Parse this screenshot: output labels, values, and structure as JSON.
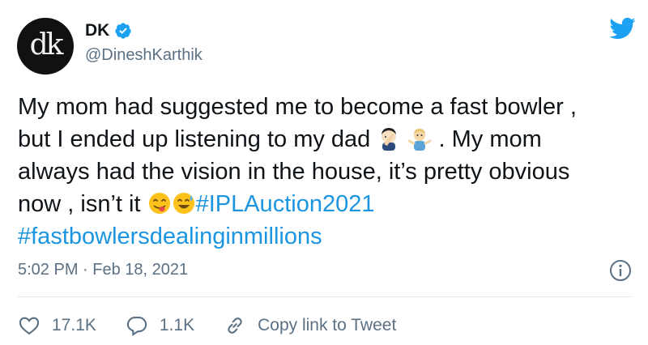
{
  "author": {
    "display_name": "DK",
    "handle": "@DineshKarthik",
    "avatar_text": "dk",
    "verified": true
  },
  "tweet": {
    "line1": "My mom had suggested me to become a fast bowler ,",
    "line2_a": "but I ended up listening to my dad",
    "line2_b": ". My mom",
    "line3": "always had the vision in the house, it’s pretty obvious",
    "line4_a": "now , isn’t it",
    "hashtag1": "#IPLAuction2021",
    "hashtag2": "#fastbowlersdealinginmillions",
    "emojis": [
      "person-facepalming-emoji",
      "person-shrugging-emoji",
      "face-savoring-food-emoji",
      "grinning-face-with-sweat-emoji"
    ]
  },
  "timestamp": "5:02 PM · Feb 18, 2021",
  "actions": {
    "likes": "17.1K",
    "replies": "1.1K",
    "copy_link": "Copy link to Tweet"
  },
  "colors": {
    "accent": "#1da1f2",
    "hashtag": "#1b95e0",
    "secondary_text": "#5b7083"
  }
}
